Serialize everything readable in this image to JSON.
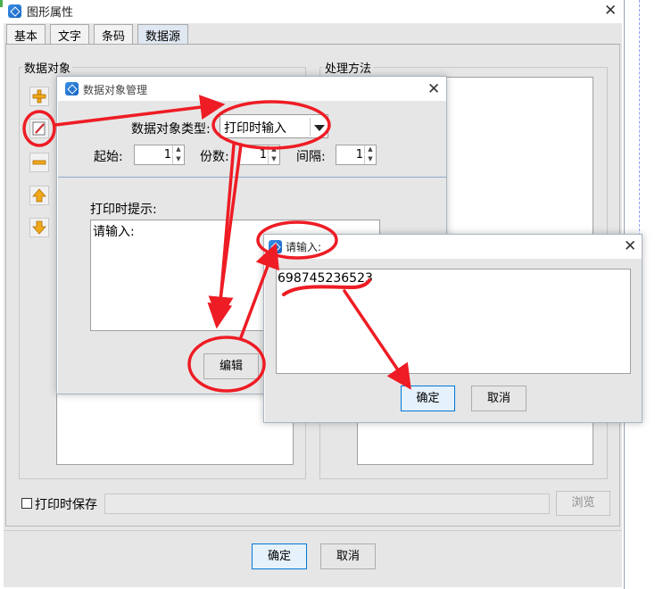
{
  "main_window": {
    "title": "图形属性",
    "tabs": [
      "基本",
      "文字",
      "条码",
      "数据源"
    ],
    "active_tab": "数据源",
    "group_data_objects": "数据对象",
    "group_processing": "处理方法",
    "save_on_print_label": "打印时保存",
    "save_on_print_checked": false,
    "browse_label": "浏览",
    "ok_label": "确定",
    "cancel_label": "取消"
  },
  "side_buttons": [
    "add-icon",
    "edit-icon",
    "remove-icon",
    "move-up-icon",
    "move-down-icon"
  ],
  "data_object_dialog": {
    "title": "数据对象管理",
    "type_label": "数据对象类型:",
    "type_value": "打印时输入",
    "start_label": "起始:",
    "start_value": "1",
    "copies_label": "份数:",
    "copies_value": "1",
    "interval_label": "间隔:",
    "interval_value": "1",
    "prompt_label": "打印时提示:",
    "prompt_value": "请输入:",
    "edit_label": "编辑"
  },
  "input_dialog": {
    "title": "请输入:",
    "value": "698745236523",
    "ok_label": "确定",
    "cancel_label": "取消"
  },
  "colors": {
    "annotation_red": "#ee1c24",
    "icon_blue": "#1f75d1",
    "focus_blue": "#0078d7",
    "frame_gray": "#e6e6e6"
  }
}
